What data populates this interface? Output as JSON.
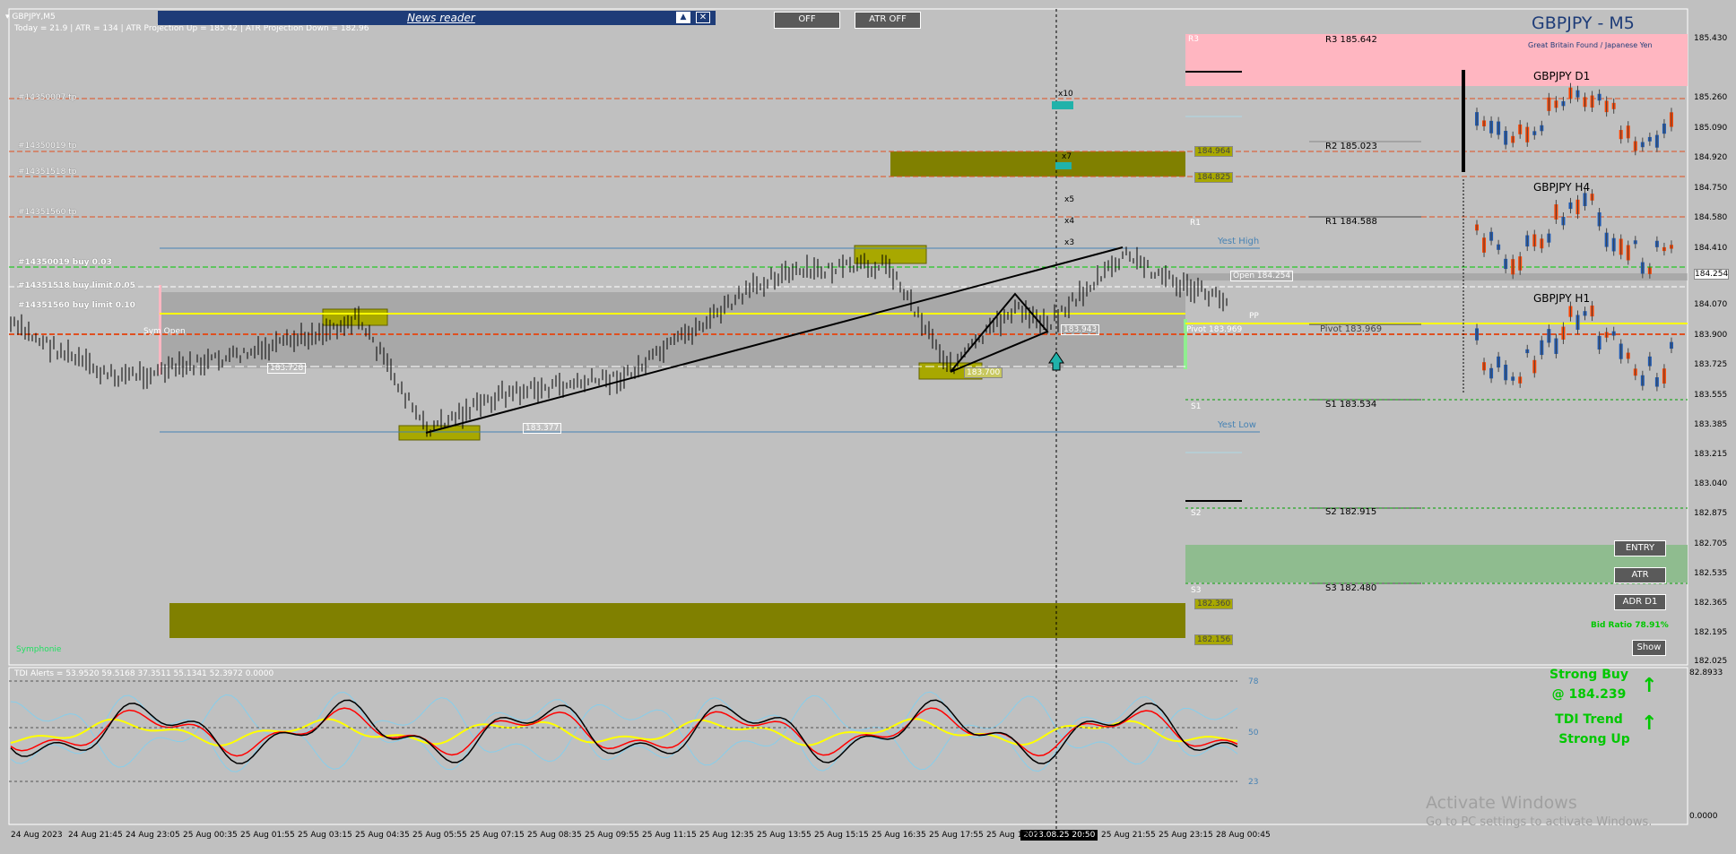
{
  "header": {
    "symbol_menu": "▾ GBPJPY,M5",
    "info_line": "Today = 21.9   |   ATR = 134   |   ATR Projection Up = 185.42   |   ATR Projection Down = 182.96",
    "news_reader": "News reader",
    "off_button": "OFF",
    "atr_off_button": "ATR OFF"
  },
  "title_panel": {
    "title": "GBPJPY - M5",
    "subtitle": "Great Britain Found / Japanese Yen"
  },
  "pivots": {
    "r3": "R3 185.642",
    "r2": "R2 185.023",
    "r1": "R1 184.588",
    "pivot": "Pivot 183.969",
    "s1": "S1 183.534",
    "s2": "S2 182.915",
    "s3": "S3 182.480",
    "yest_high": "Yest High",
    "yest_low": "Yest Low",
    "r1_short": "R1",
    "s1_short": "S1",
    "s2_short": "S2",
    "s3_short": "S3",
    "pivot_short": "Pivot",
    "r3_short": "R3",
    "pivot_value": "183.969",
    "pp": "PP"
  },
  "tp_labels": [
    "#14350007 tp",
    "#14350019 tp",
    "#14351518 tp",
    "#14351560 tp",
    "#14350019 buy 0.03",
    "#14351518 buy limit 0.05",
    "#14351560 buy limit 0.10"
  ],
  "chart_labels": {
    "sym_open": "Sym Open",
    "price_183728": "183.728",
    "price_183377": "183.377",
    "price_183700": "183.700",
    "price_183943": "183.943",
    "open_184254": "Open  184.254",
    "box_184964": "184.964",
    "box_184825": "184.825",
    "box_182360": "182.360",
    "box_182156": "182.156",
    "x10": "x10",
    "x7": "x7",
    "x5": "x5",
    "x4": "x4",
    "x3": "x3",
    "symphonie": "Symphonie",
    "current_time": "2023.08.25 20:50"
  },
  "mini_charts": {
    "d1": "GBPJPY D1",
    "h4": "GBPJPY H4",
    "h1": "GBPJPY H1"
  },
  "right_panel": {
    "entry_button": "ENTRY",
    "atr_button": "ATR",
    "adr_button": "ADR D1",
    "bid_ratio": "Bid Ratio 78.91%",
    "show_button": "Show",
    "signal1": "Strong Buy",
    "signal1b": "@ 184.239",
    "signal2": "TDI Trend",
    "signal2b": "Strong Up",
    "activate1": "Activate Windows",
    "activate2": "Go to PC settings to activate Windows."
  },
  "indicator": {
    "label": "TDI Alerts = 53.9520 59.5168 37.3511 55.1341 52.3972 0.0000",
    "lvl_78": "78",
    "lvl_50": "50",
    "lvl_23": "23",
    "top_value": "82.8933",
    "bottom_value": "0.0000"
  },
  "price_axis": [
    "185.430",
    "185.260",
    "185.090",
    "184.920",
    "184.750",
    "184.580",
    "184.410",
    "184.254",
    "184.070",
    "183.900",
    "183.725",
    "183.555",
    "183.385",
    "183.215",
    "183.040",
    "182.875",
    "182.705",
    "182.535",
    "182.365",
    "182.195",
    "182.025"
  ],
  "time_axis": [
    "24 Aug 2023",
    "24 Aug 21:45",
    "24 Aug 23:05",
    "25 Aug 00:35",
    "25 Aug 01:55",
    "25 Aug 03:15",
    "25 Aug 04:35",
    "25 Aug 05:55",
    "25 Aug 07:15",
    "25 Aug 08:35",
    "25 Aug 09:55",
    "25 Aug 11:15",
    "25 Aug 12:35",
    "25 Aug 13:55",
    "25 Aug 15:15",
    "25 Aug 16:35",
    "25 Aug 17:55",
    "25 Aug 19:15",
    "25 Aug 21:55",
    "25 Aug 23:15",
    "28 Aug 00:45"
  ],
  "colors": {
    "background": "#c0c0c0",
    "r3_zone": "#ffb6c1",
    "s3_zone": "#8fbc8f",
    "olive_zone": "#808000",
    "signal_green": "#00c800",
    "resistance_line": "#e05020"
  }
}
